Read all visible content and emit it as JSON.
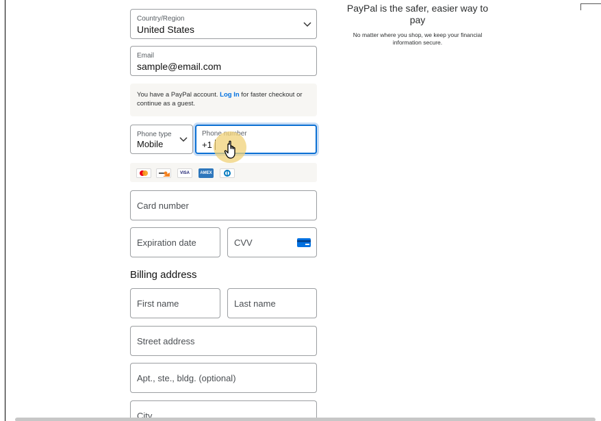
{
  "country": {
    "label": "Country/Region",
    "value": "United States"
  },
  "email": {
    "label": "Email",
    "value": "sample@email.com"
  },
  "notice": {
    "text_before": "You have a PayPal account.",
    "link": "Log In",
    "text_after": "for faster checkout or continue as a guest."
  },
  "phone_type": {
    "label": "Phone type",
    "value": "Mobile"
  },
  "phone_number": {
    "label": "Phone number",
    "prefix": "+1"
  },
  "cards": [
    "mastercard-icon",
    "discover-icon",
    "visa-icon",
    "amex-icon",
    "diners-icon"
  ],
  "card_labels": {
    "visa": "VISA",
    "amex": "AMEX"
  },
  "card_number": {
    "placeholder": "Card number"
  },
  "expiration": {
    "placeholder": "Expiration date"
  },
  "cvv": {
    "placeholder": "CVV"
  },
  "billing": {
    "title": "Billing address",
    "first_name": "First name",
    "last_name": "Last name",
    "street": "Street address",
    "apt": "Apt., ste., bldg. (optional)",
    "city": "City"
  },
  "promo": {
    "title": "PayPal is the safer, easier way to pay",
    "subtitle": "No matter where you shop, we keep your financial information secure."
  },
  "colors": {
    "link": "#0070e0",
    "focus": "#0a6fd3",
    "highlight": "#f0d278"
  }
}
